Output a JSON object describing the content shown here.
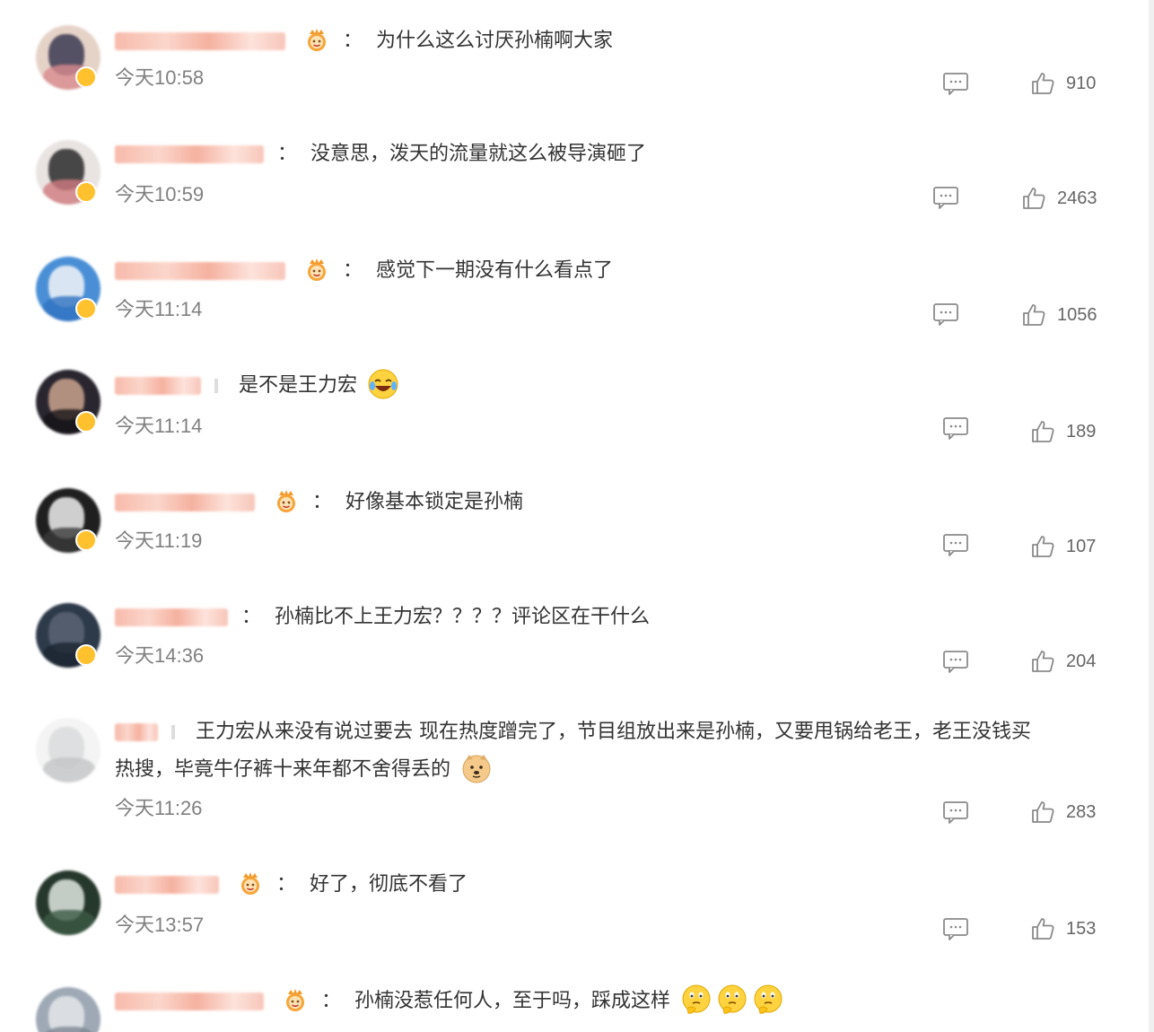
{
  "comments": [
    {
      "has_crown": true,
      "sep": "colon",
      "text": "为什么这么讨厌孙楠啊大家",
      "time": "今天10:58",
      "likes": "910",
      "avatar_colors": [
        "#e6d3c8",
        "#3b3a52",
        "#d98b8f"
      ]
    },
    {
      "has_crown": false,
      "sep": "colon",
      "text": "没意思，泼天的流量就这么被导演砸了",
      "time": "今天10:59",
      "likes": "2463",
      "avatar_colors": [
        "#e9e4e2",
        "#2b2b2b",
        "#d07a80"
      ]
    },
    {
      "has_crown": true,
      "sep": "colon",
      "text": "感觉下一期没有什么看点了",
      "time": "今天11:14",
      "likes": "1056",
      "avatar_colors": [
        "#4a8fd6",
        "#f2f5f8",
        "#2f72c1"
      ]
    },
    {
      "has_crown": false,
      "sep": "bar",
      "text": "是不是王力宏",
      "emoji": [
        "laugh-cry"
      ],
      "time": "今天11:14",
      "likes": "189",
      "avatar_colors": [
        "#2a2630",
        "#caa38d",
        "#171418"
      ]
    },
    {
      "has_crown": true,
      "sep": "colon",
      "text": "好像基本锁定是孙楠",
      "time": "今天11:19",
      "likes": "107",
      "avatar_colors": [
        "#1f1f1f",
        "#eeeeee",
        "#3a3a3a"
      ]
    },
    {
      "has_crown": false,
      "sep": "colon",
      "text": "孙楠比不上王力宏？？？？评论区在干什么",
      "time": "今天14:36",
      "likes": "204",
      "avatar_colors": [
        "#2d3a4a",
        "#5a6474",
        "#1c2430"
      ]
    },
    {
      "has_crown": false,
      "sep": "bar",
      "text": "王力宏从来没有说过要去 现在热度蹭完了，节目组放出来是孙楠，又要甩锅给老王，老王没钱买",
      "text2": "热搜，毕竟牛仔裤十来年都不舍得丢的",
      "emoji2": [
        "doge"
      ],
      "time": "今天11:26",
      "likes": "283",
      "avatar_colors": [
        "#f4f4f4",
        "#d9dadc",
        "#c2c4c7"
      ]
    },
    {
      "has_crown": true,
      "sep": "colon",
      "text": "好了，彻底不看了",
      "time": "今天13:57",
      "likes": "153",
      "avatar_colors": [
        "#26382c",
        "#dfe6e0",
        "#3c5a45"
      ]
    },
    {
      "has_crown": true,
      "sep": "colon",
      "text": "孙楠没惹任何人，至于吗，踩成这样",
      "emoji": [
        "think",
        "think",
        "think"
      ],
      "time": "",
      "likes": "",
      "avatar_colors": [
        "#9fa9b6",
        "#e4e7ea",
        "#7d8794"
      ]
    }
  ]
}
